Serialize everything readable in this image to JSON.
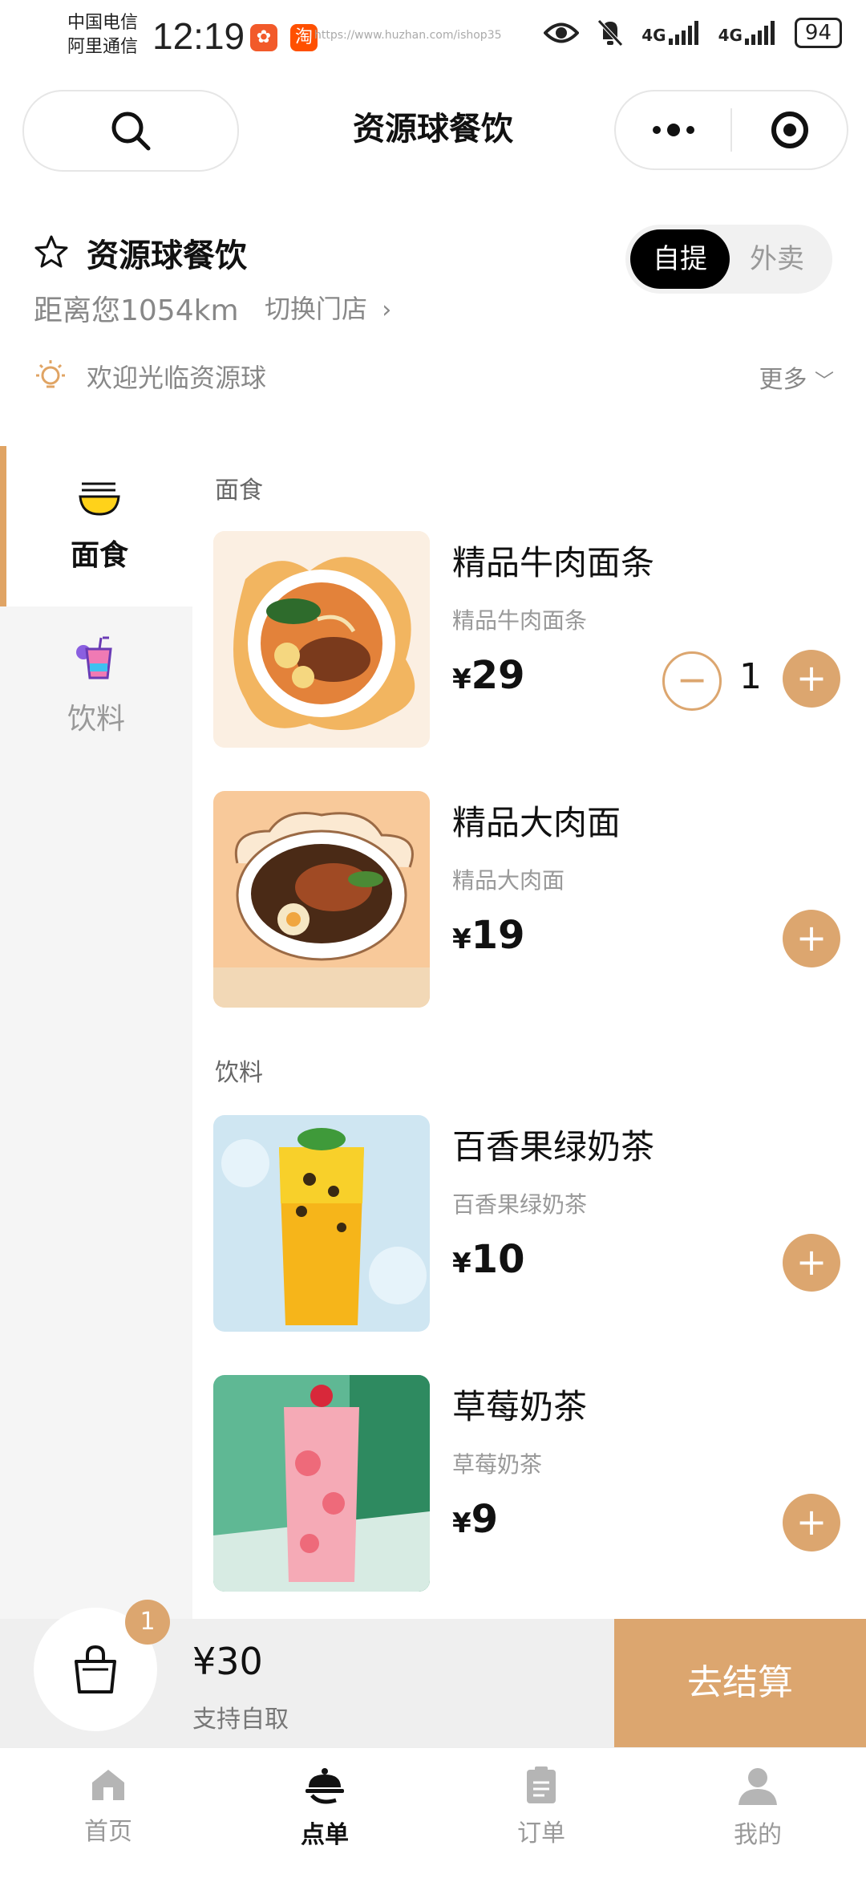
{
  "status_bar": {
    "carrier1": "中国电信",
    "carrier2": "阿里通信",
    "time": "12:19",
    "url": "https://www.huzhan.com/ishop35",
    "net1": "4G",
    "net2": "4G",
    "battery": "94"
  },
  "nav": {
    "title": "资源球餐饮"
  },
  "store": {
    "name": "资源球餐饮",
    "distance": "距离您1054km",
    "switch_store": "切换门店",
    "mode_pickup": "自提",
    "mode_delivery": "外卖",
    "notice": "欢迎光临资源球",
    "more": "更多"
  },
  "categories": [
    {
      "label": "面食",
      "icon": "noodle-bowl-icon",
      "active": true
    },
    {
      "label": "饮料",
      "icon": "drink-cup-icon",
      "active": false
    }
  ],
  "sections": [
    {
      "title": "面食",
      "items": [
        {
          "name": "精品牛肉面条",
          "desc": "精品牛肉面条",
          "currency": "¥",
          "price": "29",
          "qty": "1"
        },
        {
          "name": "精品大肉面",
          "desc": "精品大肉面",
          "currency": "¥",
          "price": "19"
        }
      ]
    },
    {
      "title": "饮料",
      "items": [
        {
          "name": "百香果绿奶茶",
          "desc": "百香果绿奶茶",
          "currency": "¥",
          "price": "10"
        },
        {
          "name": "草莓奶茶",
          "desc": "草莓奶茶",
          "currency": "¥",
          "price": "9"
        }
      ]
    }
  ],
  "cart": {
    "badge": "1",
    "total": "¥30",
    "note": "支持自取",
    "checkout": "去结算"
  },
  "tabs": [
    {
      "label": "首页",
      "icon": "home-icon"
    },
    {
      "label": "点单",
      "icon": "cloche-icon"
    },
    {
      "label": "订单",
      "icon": "clipboard-icon"
    },
    {
      "label": "我的",
      "icon": "user-icon"
    }
  ],
  "colors": {
    "accent": "#dca66f",
    "text": "#111111",
    "muted": "#999999"
  }
}
